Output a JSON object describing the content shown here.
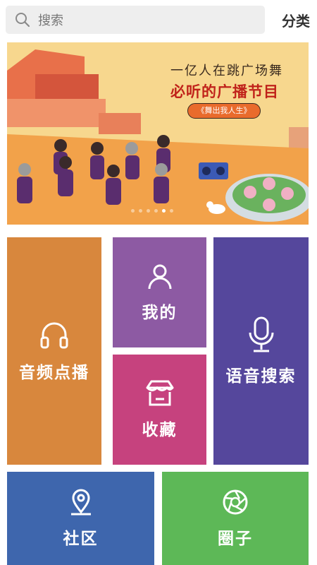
{
  "header": {
    "search_placeholder": "搜索",
    "category_label": "分类"
  },
  "banner": {
    "line1": "一亿人在跳广场舞",
    "line2": "必听的广播节目",
    "pill": "《舞出我人生》",
    "dots_count": 6,
    "active_dot": 4
  },
  "tiles": {
    "audio": "音频点播",
    "mine": "我的",
    "favorites": "收藏",
    "voice_search": "语音搜索",
    "community": "社区",
    "circle": "圈子"
  },
  "colors": {
    "audio": "#d8873d",
    "mine": "#8d5aa3",
    "favorites": "#c6427e",
    "voice_search": "#55479c",
    "community": "#3e66ad",
    "circle": "#5db857"
  },
  "icons": {
    "search": "search-icon",
    "audio": "headphones-icon",
    "mine": "user-icon",
    "favorites": "shop-box-icon",
    "voice_search": "microphone-icon",
    "community": "location-pin-icon",
    "circle": "aperture-icon"
  }
}
